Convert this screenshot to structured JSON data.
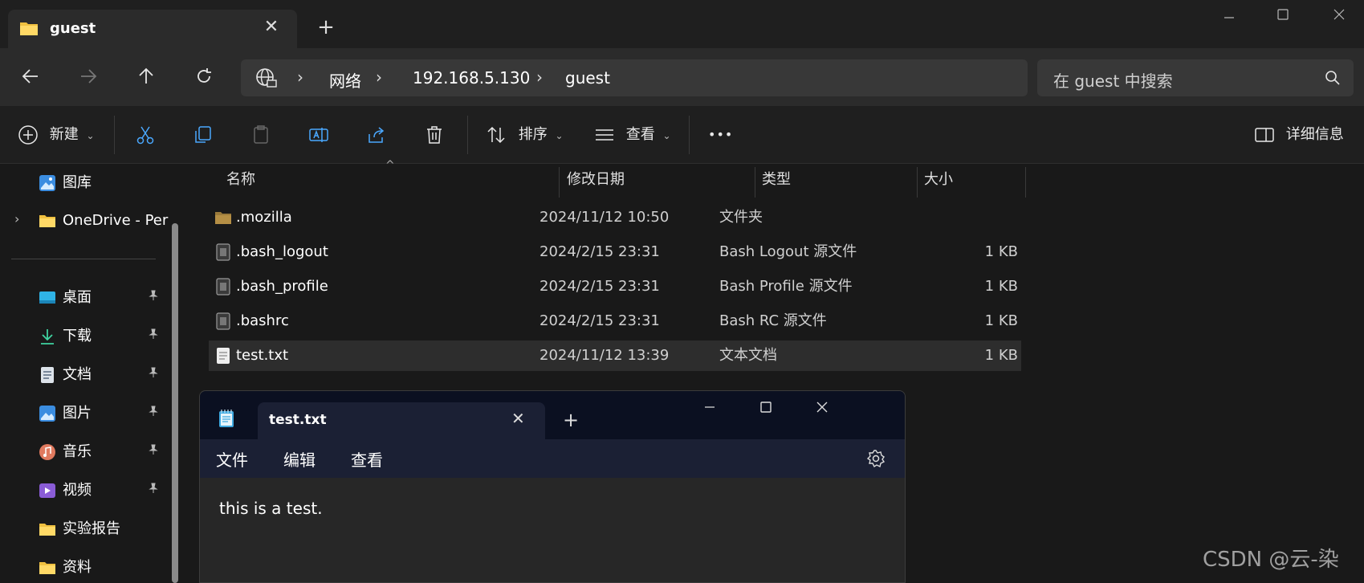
{
  "window": {
    "tab_title": "guest",
    "tab_close": "✕",
    "new_tab": "+"
  },
  "nav": {
    "breadcrumb": [
      "网络",
      "192.168.5.130",
      "guest"
    ],
    "search_placeholder": "在 guest 中搜索"
  },
  "commands": {
    "new_label": "新建",
    "sort_label": "排序",
    "view_label": "查看",
    "more_label": "•••",
    "details_label": "详细信息"
  },
  "sidebar": {
    "items": [
      {
        "label": "图库",
        "icon": "gallery-icon",
        "pinned": false
      },
      {
        "label": "OneDrive - Per",
        "icon": "onedrive-folder-icon",
        "pinned": false
      },
      {
        "label": "桌面",
        "icon": "desktop-icon",
        "pinned": true
      },
      {
        "label": "下载",
        "icon": "download-icon",
        "pinned": true
      },
      {
        "label": "文档",
        "icon": "documents-icon",
        "pinned": true
      },
      {
        "label": "图片",
        "icon": "pictures-icon",
        "pinned": true
      },
      {
        "label": "音乐",
        "icon": "music-icon",
        "pinned": true
      },
      {
        "label": "视频",
        "icon": "videos-icon",
        "pinned": true
      },
      {
        "label": "实验报告",
        "icon": "folder-icon",
        "pinned": false
      },
      {
        "label": "资料",
        "icon": "folder-icon",
        "pinned": false
      }
    ],
    "pin_glyph": "📌"
  },
  "filelist": {
    "columns": [
      "名称",
      "修改日期",
      "类型",
      "大小"
    ],
    "rows": [
      {
        "name": ".mozilla",
        "date": "2024/11/12 10:50",
        "type": "文件夹",
        "size": "",
        "icon": "folder-icon",
        "selected": false
      },
      {
        "name": ".bash_logout",
        "date": "2024/2/15 23:31",
        "type": "Bash Logout 源文件",
        "size": "1 KB",
        "icon": "file-icon",
        "selected": false
      },
      {
        "name": ".bash_profile",
        "date": "2024/2/15 23:31",
        "type": "Bash Profile 源文件",
        "size": "1 KB",
        "icon": "file-icon",
        "selected": false
      },
      {
        "name": ".bashrc",
        "date": "2024/2/15 23:31",
        "type": "Bash RC 源文件",
        "size": "1 KB",
        "icon": "file-icon",
        "selected": false
      },
      {
        "name": "test.txt",
        "date": "2024/11/12 13:39",
        "type": "文本文档",
        "size": "1 KB",
        "icon": "text-file-icon",
        "selected": true
      }
    ]
  },
  "notepad": {
    "tab_title": "test.txt",
    "menu": [
      "文件",
      "编辑",
      "查看"
    ],
    "content": "this is a test."
  },
  "watermark": "CSDN @云-染",
  "colors": {
    "background": "#191919",
    "folder_yellow": "#f0c040",
    "notepad_title": "#0b1021",
    "selected_row": "#2d2d2d"
  }
}
